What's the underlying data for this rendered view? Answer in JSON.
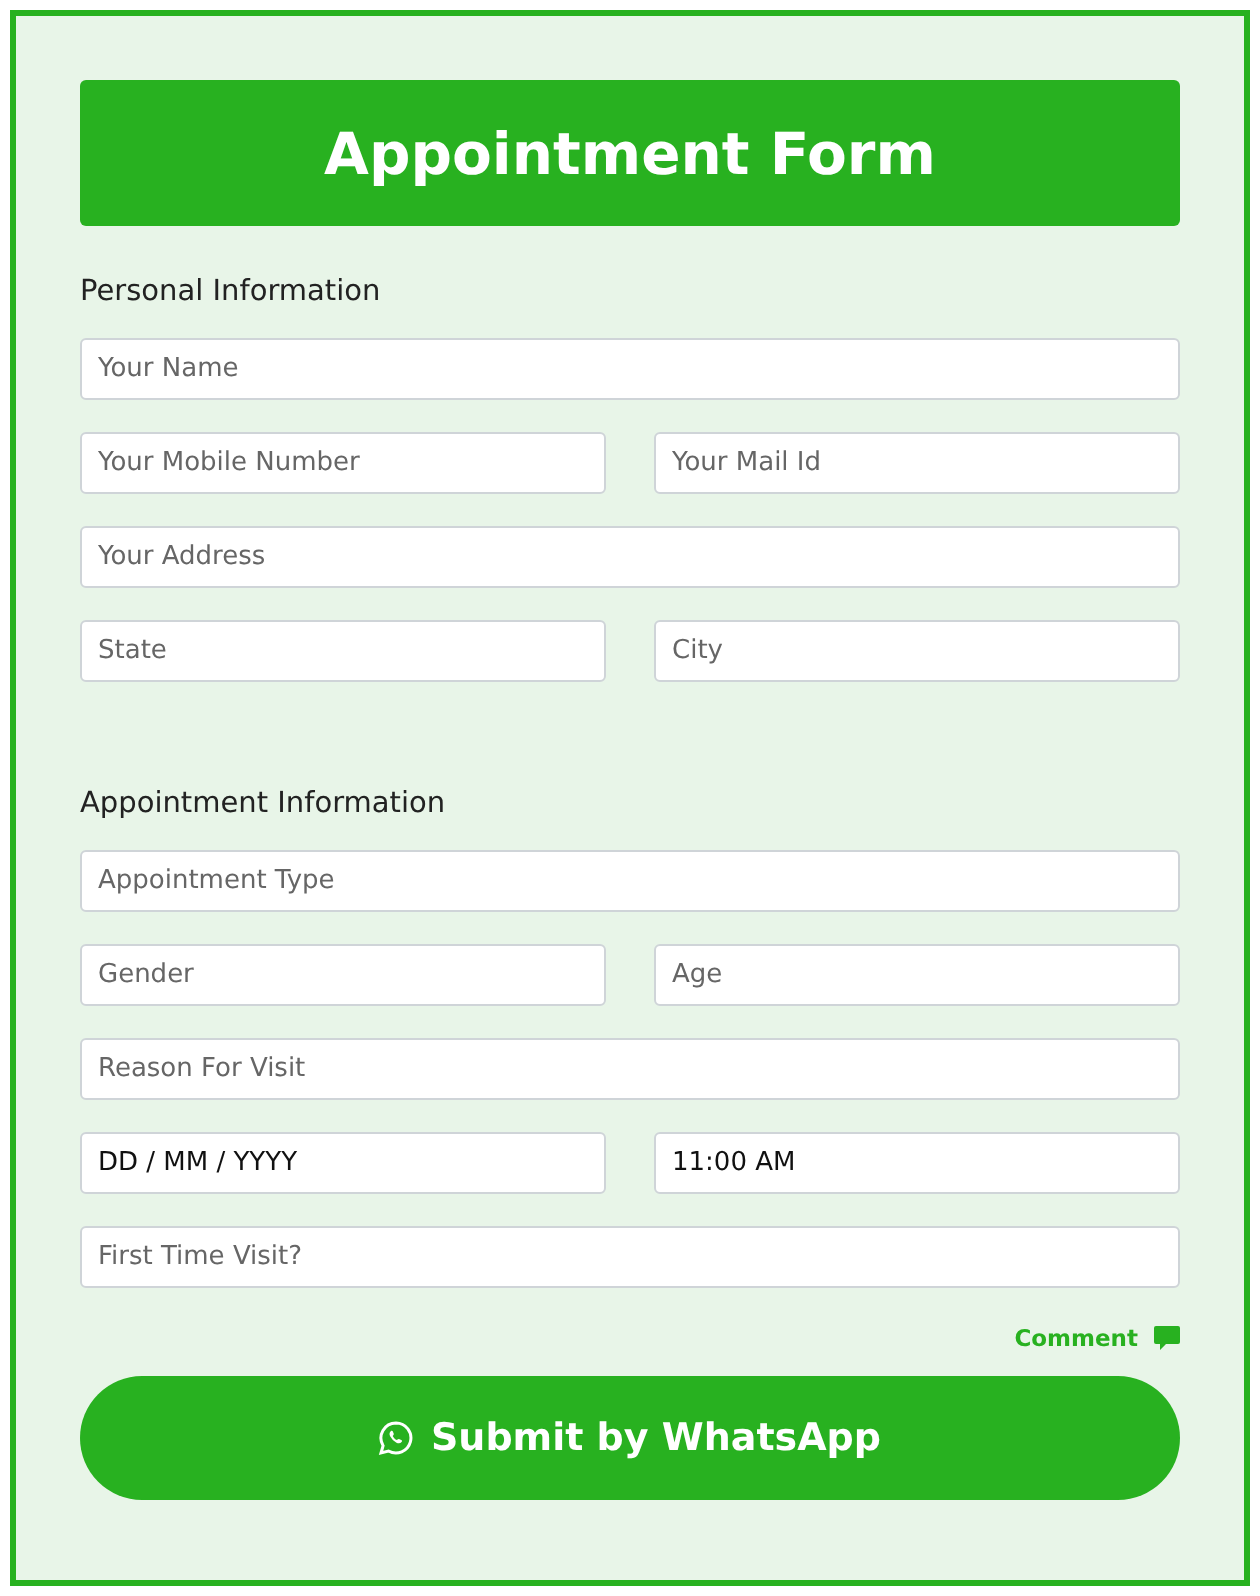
{
  "title": "Appointment Form",
  "sections": [
    {
      "heading": "Personal Information",
      "rows": [
        [
          {
            "placeholder": "Your Name"
          }
        ],
        [
          {
            "placeholder": "Your Mobile Number"
          },
          {
            "placeholder": "Your Mail Id"
          }
        ],
        [
          {
            "placeholder": "Your Address"
          }
        ],
        [
          {
            "placeholder": "State"
          },
          {
            "placeholder": "City"
          }
        ]
      ]
    },
    {
      "heading": "Appointment Information",
      "rows": [
        [
          {
            "placeholder": "Appointment Type"
          }
        ],
        [
          {
            "placeholder": "Gender"
          },
          {
            "placeholder": "Age"
          }
        ],
        [
          {
            "placeholder": "Reason For Visit"
          }
        ],
        [
          {
            "value": "DD / MM / YYYY"
          },
          {
            "value": "11:00 AM"
          }
        ],
        [
          {
            "placeholder": "First Time Visit?"
          }
        ]
      ]
    }
  ],
  "comment_link": "Comment",
  "submit_button": "Submit by WhatsApp"
}
